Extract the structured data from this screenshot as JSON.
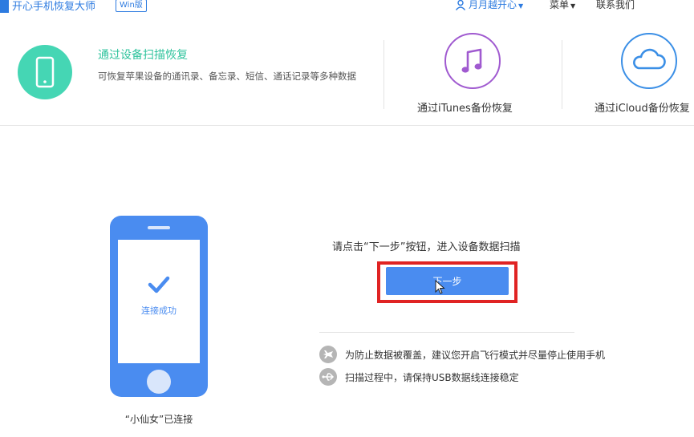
{
  "titlebar": {
    "app_title": "开心手机恢复大师",
    "edition_badge": "Win版",
    "user_name": "月月越开心",
    "menu_label": "菜单",
    "contact_label": "联系我们"
  },
  "modes": [
    {
      "title": "通过设备扫描恢复",
      "description": "可恢复苹果设备的通讯录、备忘录、短信、通话记录等多种数据",
      "icon": "phone-icon",
      "color": "#45d6b4",
      "active": true
    },
    {
      "label": "通过iTunes备份恢复",
      "icon": "music-note-icon",
      "color": "#a05ad0"
    },
    {
      "label": "通过iCloud备份恢复",
      "icon": "cloud-icon",
      "color": "#3b8fe6"
    }
  ],
  "phone": {
    "status": "连接成功",
    "device_name": "“小仙女”已连接"
  },
  "main": {
    "prompt": "请点击“下一步”按钮，进入设备数据扫描",
    "next_button": "下一步",
    "accent_color": "#4a8cf0",
    "highlight_color": "#e02323"
  },
  "tips": [
    {
      "icon": "airplane-icon",
      "text": "为防止数据被覆盖，建议您开启飞行模式并尽量停止使用手机"
    },
    {
      "icon": "usb-icon",
      "text": "扫描过程中，请保持USB数据线连接稳定"
    }
  ]
}
